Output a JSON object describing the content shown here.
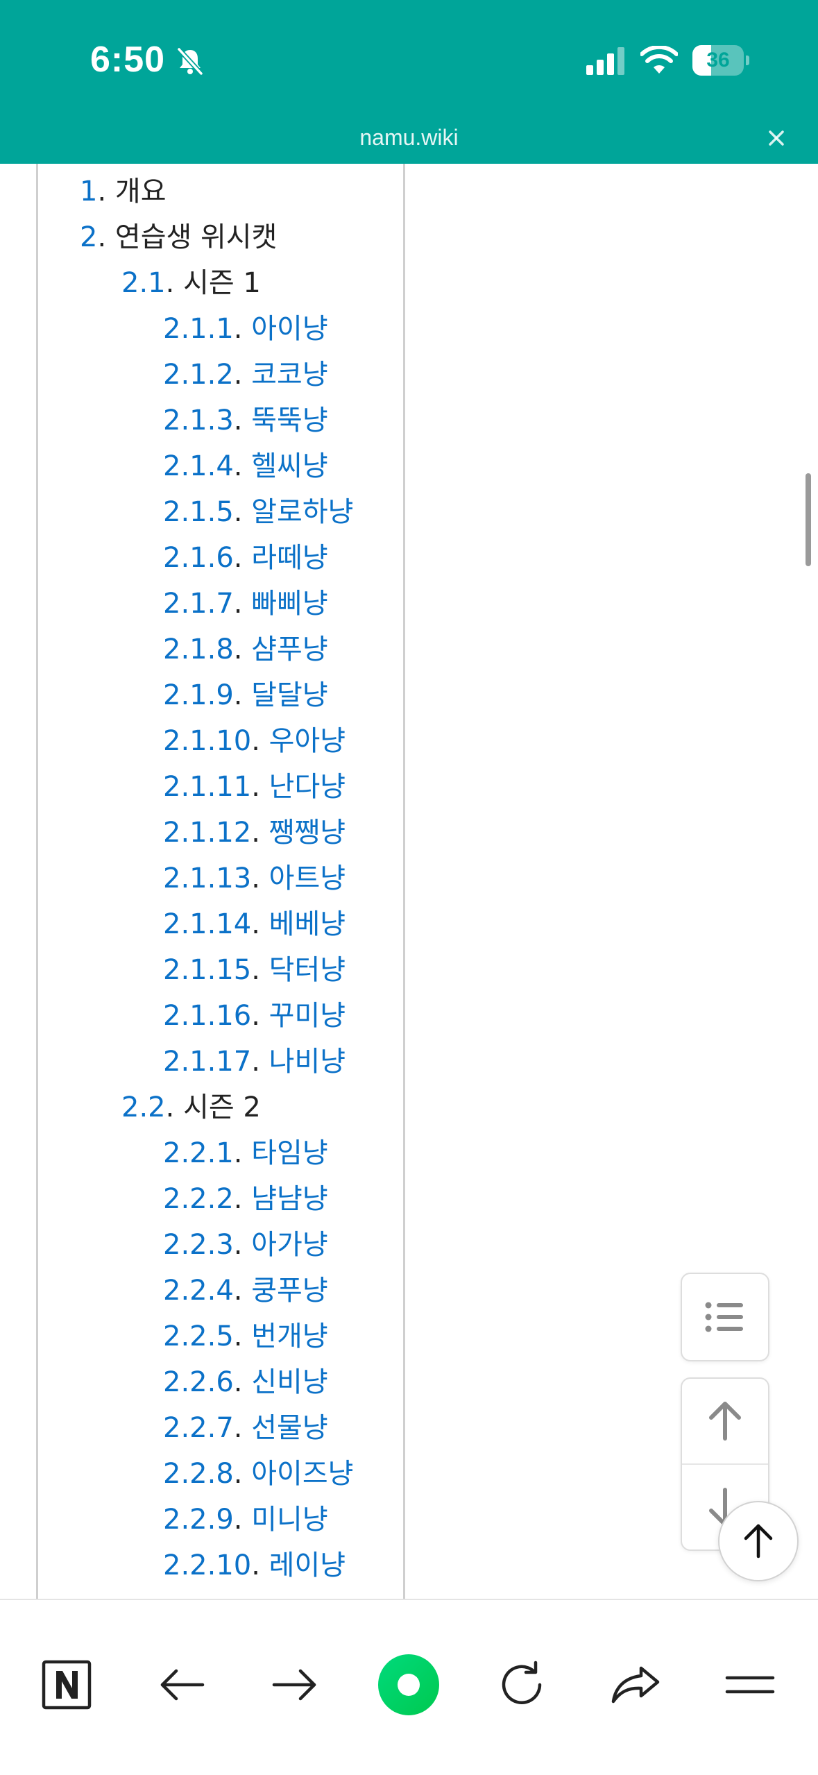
{
  "colors": {
    "brand": "#00A599",
    "link": "#0B71C8",
    "text": "#222222",
    "green_button": "#00D26A"
  },
  "status_bar": {
    "time": "6:50",
    "battery_level": "36",
    "battery_fraction": 0.36,
    "icons": [
      "bell-slash-icon",
      "cellular-signal-icon",
      "wifi-icon",
      "battery-icon"
    ]
  },
  "browser": {
    "url": "namu.wiki",
    "close_icon": "close-icon"
  },
  "toc": {
    "items": [
      {
        "num": "1",
        "title": "개요",
        "level": 1,
        "title_link": false
      },
      {
        "num": "2",
        "title": "연습생 위시캣",
        "level": 1,
        "title_link": false
      },
      {
        "num": "2.1",
        "title": "시즌 1",
        "level": 2,
        "title_link": false
      },
      {
        "num": "2.1.1",
        "title": "아이냥",
        "level": 3,
        "title_link": true
      },
      {
        "num": "2.1.2",
        "title": "코코냥",
        "level": 3,
        "title_link": true
      },
      {
        "num": "2.1.3",
        "title": "뚝뚝냥",
        "level": 3,
        "title_link": true
      },
      {
        "num": "2.1.4",
        "title": "헬씨냥",
        "level": 3,
        "title_link": true
      },
      {
        "num": "2.1.5",
        "title": "알로하냥",
        "level": 3,
        "title_link": true
      },
      {
        "num": "2.1.6",
        "title": "라떼냥",
        "level": 3,
        "title_link": true
      },
      {
        "num": "2.1.7",
        "title": "빠삐냥",
        "level": 3,
        "title_link": true
      },
      {
        "num": "2.1.8",
        "title": "샴푸냥",
        "level": 3,
        "title_link": true
      },
      {
        "num": "2.1.9",
        "title": "달달냥",
        "level": 3,
        "title_link": true
      },
      {
        "num": "2.1.10",
        "title": "우아냥",
        "level": 3,
        "title_link": true
      },
      {
        "num": "2.1.11",
        "title": "난다냥",
        "level": 3,
        "title_link": true
      },
      {
        "num": "2.1.12",
        "title": "쨍쨍냥",
        "level": 3,
        "title_link": true
      },
      {
        "num": "2.1.13",
        "title": "아트냥",
        "level": 3,
        "title_link": true
      },
      {
        "num": "2.1.14",
        "title": "베베냥",
        "level": 3,
        "title_link": true
      },
      {
        "num": "2.1.15",
        "title": "닥터냥",
        "level": 3,
        "title_link": true
      },
      {
        "num": "2.1.16",
        "title": "꾸미냥",
        "level": 3,
        "title_link": true
      },
      {
        "num": "2.1.17",
        "title": "나비냥",
        "level": 3,
        "title_link": true
      },
      {
        "num": "2.2",
        "title": "시즌 2",
        "level": 2,
        "title_link": false
      },
      {
        "num": "2.2.1",
        "title": "타임냥",
        "level": 3,
        "title_link": true
      },
      {
        "num": "2.2.2",
        "title": "냠냠냥",
        "level": 3,
        "title_link": true
      },
      {
        "num": "2.2.3",
        "title": "아가냥",
        "level": 3,
        "title_link": true
      },
      {
        "num": "2.2.4",
        "title": "쿵푸냥",
        "level": 3,
        "title_link": true
      },
      {
        "num": "2.2.5",
        "title": "번개냥",
        "level": 3,
        "title_link": true
      },
      {
        "num": "2.2.6",
        "title": "신비냥",
        "level": 3,
        "title_link": true
      },
      {
        "num": "2.2.7",
        "title": "선물냥",
        "level": 3,
        "title_link": true
      },
      {
        "num": "2.2.8",
        "title": "아이즈냥",
        "level": 3,
        "title_link": true
      },
      {
        "num": "2.2.9",
        "title": "미니냥",
        "level": 3,
        "title_link": true
      },
      {
        "num": "2.2.10",
        "title": "레이냥",
        "level": 3,
        "title_link": true
      }
    ]
  },
  "floating_controls": {
    "toc_icon": "list-icon",
    "up_icon": "arrow-up-icon",
    "down_icon": "arrow-down-icon",
    "scroll_top_icon": "arrow-up-icon"
  },
  "toolbar": {
    "buttons": [
      {
        "name": "naver-home-button",
        "icon": "naver-n-icon"
      },
      {
        "name": "back-button",
        "icon": "arrow-left-icon"
      },
      {
        "name": "forward-button",
        "icon": "arrow-right-icon"
      },
      {
        "name": "green-dot-button",
        "icon": "green-circle-icon"
      },
      {
        "name": "reload-button",
        "icon": "reload-icon"
      },
      {
        "name": "share-button",
        "icon": "share-icon"
      },
      {
        "name": "menu-button",
        "icon": "menu-icon"
      }
    ]
  }
}
